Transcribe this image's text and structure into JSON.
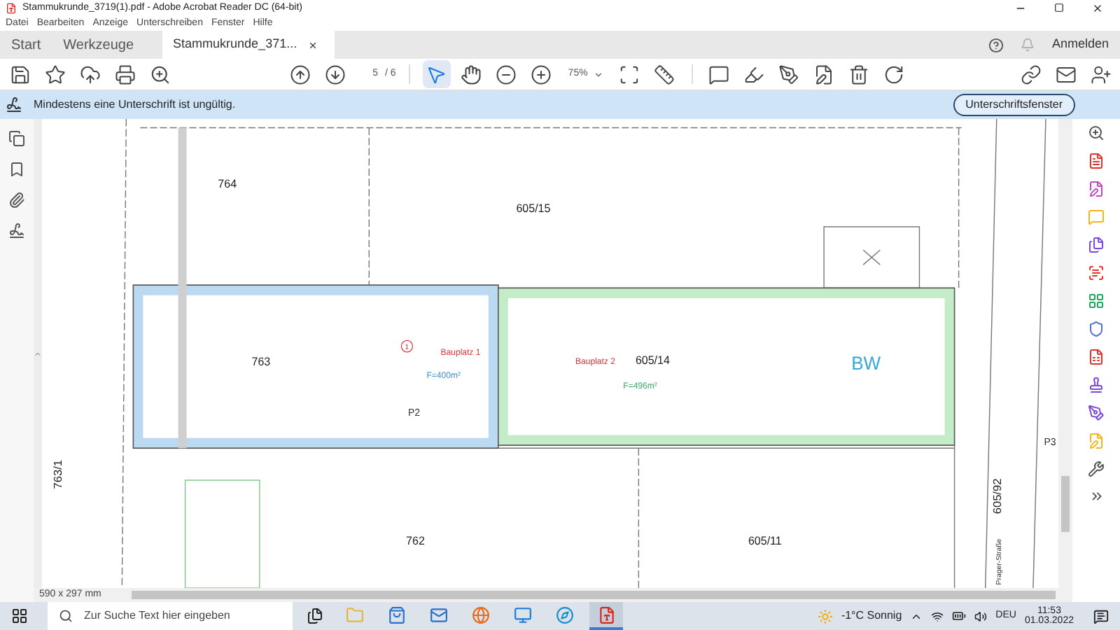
{
  "window": {
    "title": "Stammukrunde_3719(1).pdf - Adobe Acrobat Reader DC (64-bit)"
  },
  "menu": [
    "Datei",
    "Bearbeiten",
    "Anzeige",
    "Unterschreiben",
    "Fenster",
    "Hilfe"
  ],
  "tabs": [
    {
      "label": "Start",
      "selected": false,
      "closable": false
    },
    {
      "label": "Werkzeuge",
      "selected": false,
      "closable": false
    },
    {
      "label": "Stammukrunde_371...",
      "selected": true,
      "closable": true
    }
  ],
  "account": {
    "label": "Anmelden"
  },
  "toolbar": {
    "page": {
      "value": "5",
      "total": "/ 6"
    },
    "zoom": "75%",
    "tools": [
      {
        "kind": "select",
        "selected": true
      },
      {
        "kind": "hand",
        "selected": false
      }
    ]
  },
  "notification": {
    "message": "Mindestens eine Unterschrift ist ungültig.",
    "button": "Unterschriftsfenster"
  },
  "map": {
    "plots": [
      {
        "name": "Bauplatz 1",
        "area": "F=400m²",
        "color": "#bcd9f2"
      },
      {
        "name": "Bauplatz 2",
        "area": "F=496m²",
        "color": "#c4ecc8"
      }
    ],
    "labels": [
      {
        "text": "764",
        "kind": "parcel"
      },
      {
        "text": "605/15",
        "kind": "parcel"
      },
      {
        "text": "763",
        "kind": "parcel"
      },
      {
        "text": "1",
        "kind": "marker"
      },
      {
        "text": "P2",
        "kind": "point"
      },
      {
        "text": "605/14",
        "kind": "parcel"
      },
      {
        "text": "BW",
        "kind": "zone"
      },
      {
        "text": "763/1",
        "kind": "vparcel"
      },
      {
        "text": "605/92",
        "kind": "vparcel"
      },
      {
        "text": "Prager-Straße",
        "kind": "street"
      },
      {
        "text": "P3",
        "kind": "point"
      },
      {
        "text": "762",
        "kind": "parcel"
      },
      {
        "text": "605/11",
        "kind": "parcel"
      }
    ]
  },
  "status": {
    "page_size": "590 x 297 mm"
  },
  "taskbar": {
    "search": {
      "placeholder": "Zur Suche Text hier eingeben"
    },
    "apps": [
      {
        "kind": "explorer",
        "selected": false
      },
      {
        "kind": "store",
        "selected": false
      },
      {
        "kind": "mail",
        "selected": false
      },
      {
        "kind": "firefox",
        "selected": false
      },
      {
        "kind": "remote",
        "selected": false
      },
      {
        "kind": "edge",
        "selected": false
      },
      {
        "kind": "acrobat",
        "selected": true
      }
    ],
    "weather": "-1°C Sonnig",
    "language": "DEU",
    "time": "11:53",
    "date": "01.03.2022"
  }
}
